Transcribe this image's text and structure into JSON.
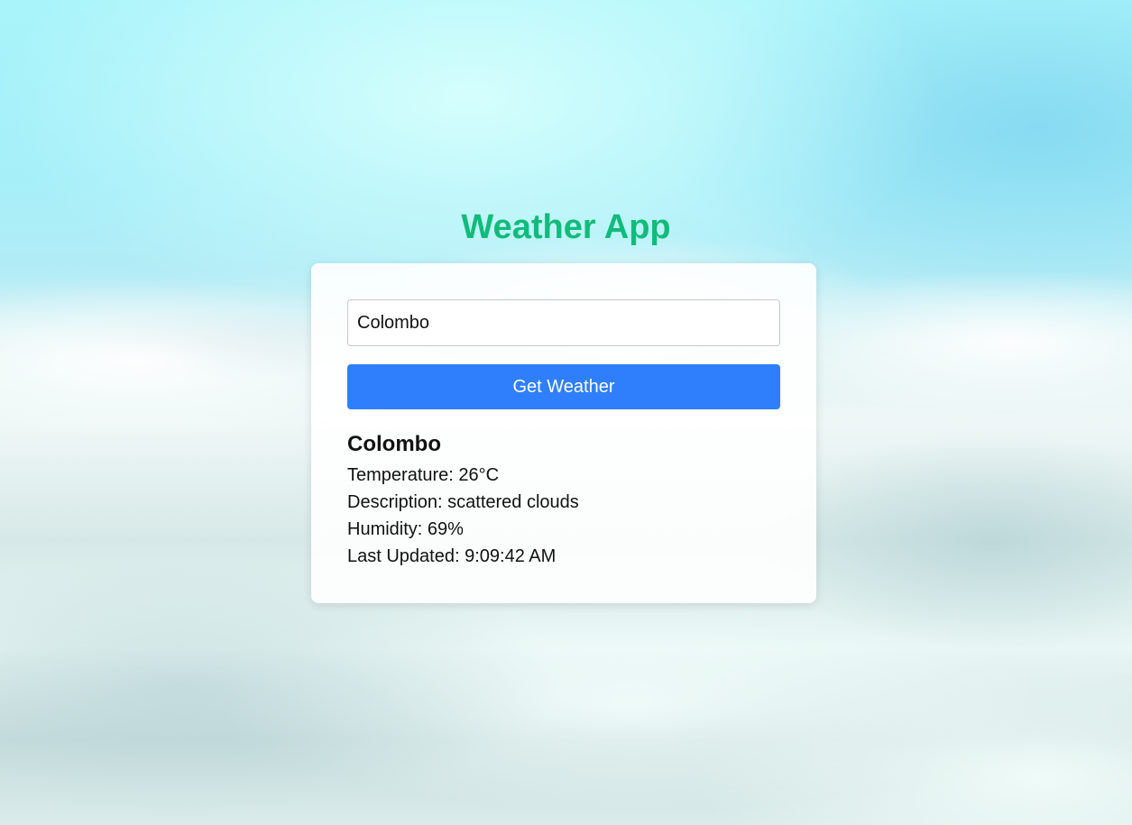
{
  "app": {
    "title": "Weather App",
    "accent_color": "#11bb7a",
    "button_color": "#2f7ffc"
  },
  "search": {
    "value": "Colombo",
    "button_label": "Get Weather"
  },
  "result": {
    "city": "Colombo",
    "temperature": "Temperature: 26°C",
    "description": "Description: scattered clouds",
    "humidity": "Humidity: 69%",
    "last_updated": "Last Updated: 9:09:42 AM"
  }
}
